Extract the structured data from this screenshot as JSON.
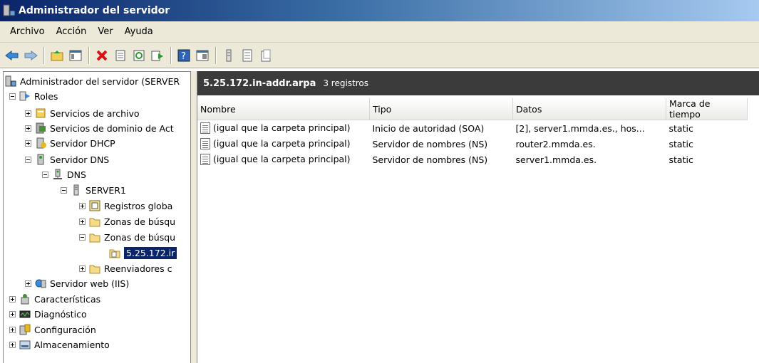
{
  "window": {
    "title": "Administrador del servidor"
  },
  "menu": {
    "items": [
      "Archivo",
      "Acción",
      "Ver",
      "Ayuda"
    ]
  },
  "toolbar": {
    "buttons": [
      "back-icon",
      "forward-icon",
      "up-folder-icon",
      "show-tree-icon",
      "delete-icon",
      "properties-icon",
      "refresh-icon",
      "export-icon",
      "help-icon",
      "console-icon",
      "record-icon",
      "list-icon",
      "new-record-icon"
    ]
  },
  "tree": {
    "root": "Administrador del servidor (SERVER",
    "roles": "Roles",
    "file_services": "Servicios de archivo",
    "ad_services": "Servicios de dominio de Act",
    "dhcp": "Servidor DHCP",
    "dns_server": "Servidor DNS",
    "dns": "DNS",
    "server1": "SERVER1",
    "global_logs": "Registros globa",
    "forward_zones": "Zonas de búsqu",
    "reverse_zones": "Zonas de búsqu",
    "selected_zone": "5.25.172.ir",
    "forwarders": "Reenviadores c",
    "iis": "Servidor web (IIS)",
    "features": "Características",
    "diagnostics": "Diagnóstico",
    "configuration": "Configuración",
    "storage": "Almacenamiento"
  },
  "detail": {
    "zone_name": "5.25.172.in-addr.arpa",
    "record_count": "3 registros",
    "columns": [
      "Nombre",
      "Tipo",
      "Datos",
      "Marca de tiempo"
    ],
    "rows": [
      {
        "name": "(igual que la carpeta principal)",
        "type": "Inicio de autoridad (SOA)",
        "data": "[2], server1.mmda.es., hos...",
        "timestamp": "static"
      },
      {
        "name": "(igual que la carpeta principal)",
        "type": "Servidor de nombres (NS)",
        "data": "router2.mmda.es.",
        "timestamp": "static"
      },
      {
        "name": "(igual que la carpeta principal)",
        "type": "Servidor de nombres (NS)",
        "data": "server1.mmda.es.",
        "timestamp": "static"
      }
    ]
  },
  "colors": {
    "title_start": "#0a246a",
    "title_end": "#a6caf0",
    "header_bg": "#3b3b3b",
    "chrome": "#ece9d8"
  }
}
